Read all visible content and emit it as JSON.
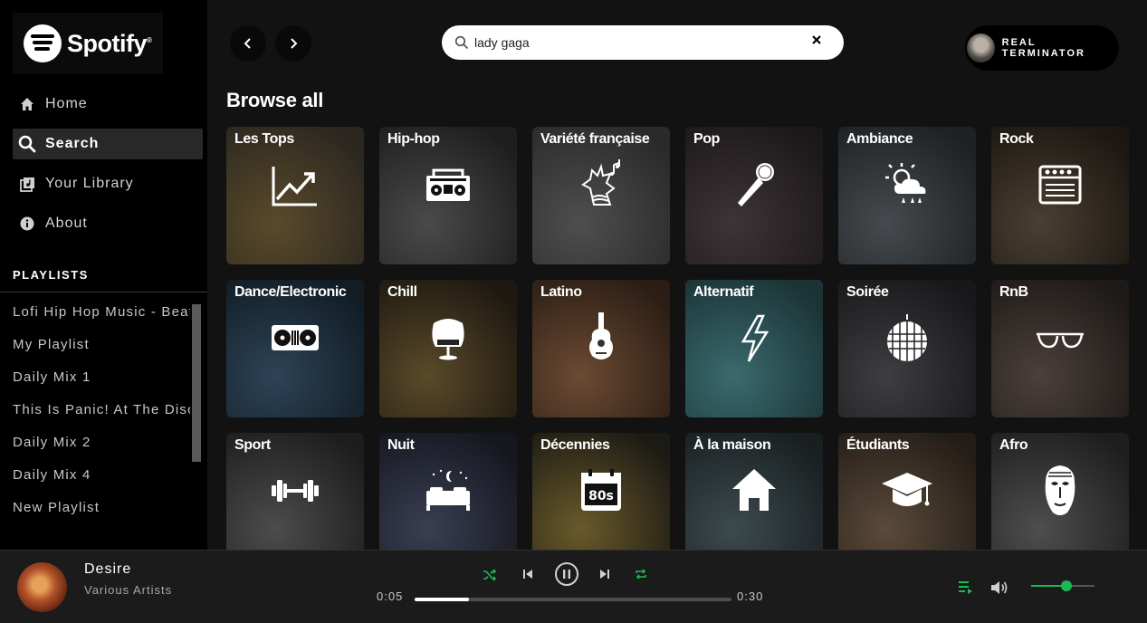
{
  "app": {
    "name": "Spotify"
  },
  "sidebar": {
    "nav": [
      {
        "label": "Home",
        "icon": "home-icon",
        "active": false
      },
      {
        "label": "Search",
        "icon": "search-icon",
        "active": true
      },
      {
        "label": "Your Library",
        "icon": "library-icon",
        "active": false
      },
      {
        "label": "About",
        "icon": "info-icon",
        "active": false
      }
    ],
    "playlists_title": "PLAYLISTS",
    "playlists": [
      "Lofi Hip Hop Music - Beats to Relax/Study To",
      "My Playlist",
      "Daily Mix 1",
      "This Is Panic! At The Disco",
      "Daily Mix 2",
      "Daily Mix 4",
      "New Playlist"
    ]
  },
  "header": {
    "search_value": "lady gaga",
    "user_name": "REAL TERMINATOR"
  },
  "browse": {
    "title": "Browse all",
    "categories": [
      {
        "label": "Les Tops",
        "icon": "trending-up-icon",
        "bg": [
          "#5a4a2a",
          "#2b2720"
        ]
      },
      {
        "label": "Hip-hop",
        "icon": "boombox-icon",
        "bg": [
          "#4a4a4a",
          "#1e1e1e"
        ]
      },
      {
        "label": "Variété française",
        "icon": "rooster-icon",
        "bg": [
          "#4e4e4e",
          "#2a2a2a"
        ]
      },
      {
        "label": "Pop",
        "icon": "microphone-icon",
        "bg": [
          "#3d3436",
          "#1c1819"
        ]
      },
      {
        "label": "Ambiance",
        "icon": "weather-icon",
        "bg": [
          "#454a4e",
          "#1e2123"
        ]
      },
      {
        "label": "Rock",
        "icon": "amplifier-icon",
        "bg": [
          "#4a3f33",
          "#1c1712"
        ]
      },
      {
        "label": "Dance/Electronic",
        "icon": "turntable-icon",
        "bg": [
          "#2d4356",
          "#111c25"
        ]
      },
      {
        "label": "Chill",
        "icon": "egg-chair-icon",
        "bg": [
          "#5a4a2a",
          "#1e1810"
        ]
      },
      {
        "label": "Latino",
        "icon": "guitar-icon",
        "bg": [
          "#6b4a33",
          "#2b1d14"
        ]
      },
      {
        "label": "Alternatif",
        "icon": "lightning-icon",
        "bg": [
          "#3a6a6e",
          "#1b3335"
        ]
      },
      {
        "label": "Soirée",
        "icon": "disco-ball-icon",
        "bg": [
          "#3e3e42",
          "#18181a"
        ]
      },
      {
        "label": "RnB",
        "icon": "sunglasses-icon",
        "bg": [
          "#4b403b",
          "#1e1a18"
        ]
      },
      {
        "label": "Sport",
        "icon": "dumbbell-icon",
        "bg": [
          "#4c4c4c",
          "#1d1d1d"
        ]
      },
      {
        "label": "Nuit",
        "icon": "bed-icon",
        "bg": [
          "#3a3e52",
          "#15171f"
        ]
      },
      {
        "label": "Décennies",
        "icon": "calendar-80s-icon",
        "bg": [
          "#6a5a2a",
          "#1c1a14"
        ]
      },
      {
        "label": "À la maison",
        "icon": "house-icon",
        "bg": [
          "#3c4a4e",
          "#191f21"
        ]
      },
      {
        "label": "Étudiants",
        "icon": "graduation-cap-icon",
        "bg": [
          "#5a4a3a",
          "#241d17"
        ]
      },
      {
        "label": "Afro",
        "icon": "african-mask-icon",
        "bg": [
          "#4e4e4e",
          "#1e1e1e"
        ]
      }
    ]
  },
  "player": {
    "track_title": "Desire",
    "track_artist": "Various Artists",
    "current_time": "0:05",
    "total_time": "0:30",
    "progress": 0.17,
    "volume": 0.55,
    "accent": "#1db954"
  }
}
